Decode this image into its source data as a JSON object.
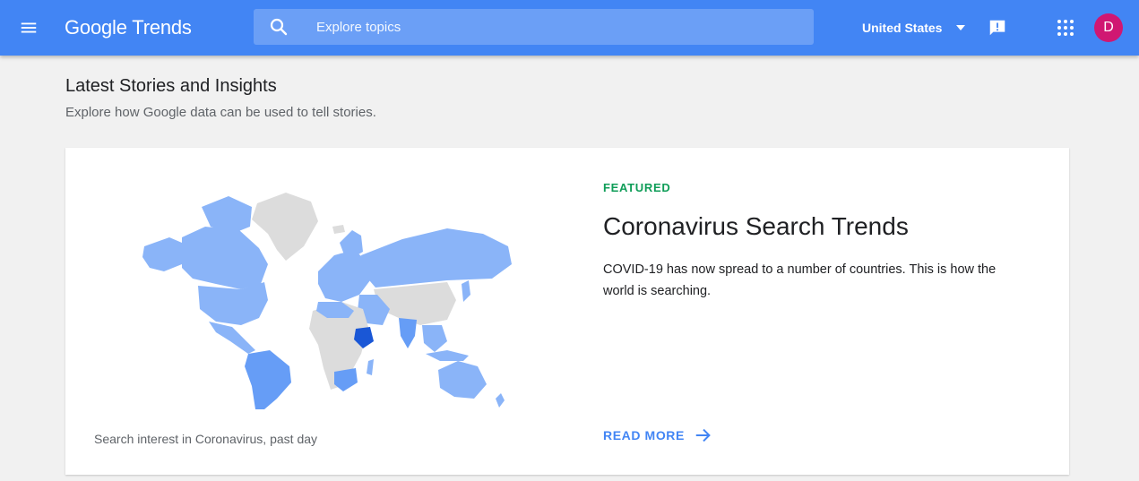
{
  "header": {
    "logo_brand": "Google",
    "logo_product": "Trends",
    "search_placeholder": "Explore topics",
    "region": "United States",
    "avatar_initial": "D"
  },
  "section": {
    "title": "Latest Stories and Insights",
    "subtitle": "Explore how Google data can be used to tell stories."
  },
  "featured_story": {
    "label": "FEATURED",
    "title": "Coronavirus Search Trends",
    "description": "COVID-19 has now spread to a number of countries. This is how the world is searching.",
    "read_more": "READ MORE",
    "map_caption": "Search interest in Coronavirus, past day"
  },
  "colors": {
    "header_bg": "#4285f4",
    "featured_green": "#0f9d58",
    "avatar_bg": "#d01772",
    "map_light": "#8ab4f8",
    "map_mid": "#669df6",
    "map_dark": "#1a57d6",
    "map_nodata": "#dcdcdc"
  }
}
